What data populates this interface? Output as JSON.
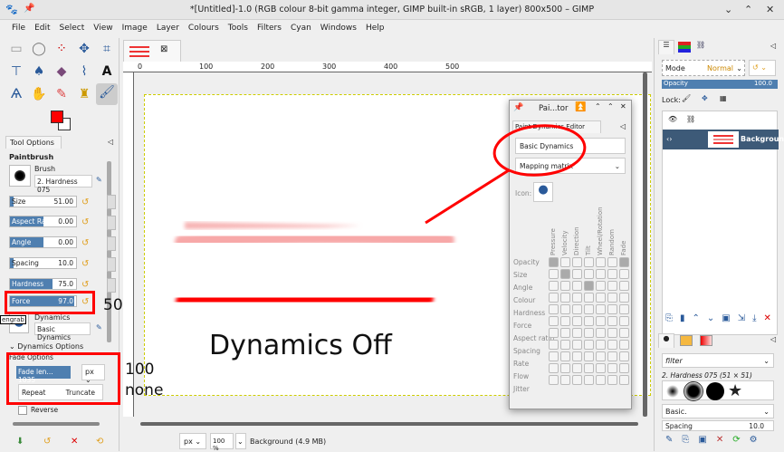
{
  "window": {
    "title": "*[Untitled]-1.0 (RGB colour 8-bit gamma integer, GIMP built-in sRGB, 1 layer) 800x500 – GIMP"
  },
  "menu": [
    "File",
    "Edit",
    "Select",
    "View",
    "Image",
    "Layer",
    "Colours",
    "Tools",
    "Filters",
    "Cyan",
    "Windows",
    "Help"
  ],
  "colors": {
    "foreground": "#ff0000",
    "background": "#ffffff",
    "accent": "#4f7fb0",
    "annotation": "#ff0000"
  },
  "tool_options": {
    "tab": "Tool Options",
    "tool": "Paintbrush",
    "brush_label": "Brush",
    "brush": "2. Hardness 075",
    "sliders": [
      {
        "label": "Size",
        "value": "51.00",
        "fill": 0.05
      },
      {
        "label": "Aspect Ra...",
        "value": "0.00",
        "fill": 0.5
      },
      {
        "label": "Angle",
        "value": "0.00",
        "fill": 0.5
      },
      {
        "label": "Spacing",
        "value": "10.0",
        "fill": 0.05
      },
      {
        "label": "Hardness",
        "value": "75.0",
        "fill": 0.75
      },
      {
        "label": "Force",
        "value": "97.0",
        "fill": 0.97
      }
    ],
    "dynamics_label": "Dynamics",
    "dynamics": "Basic Dynamics",
    "dynamics_options": "Dynamics Options",
    "fade_options": "Fade Options",
    "fade_length_label": "Fade len...",
    "fade_length": "1035",
    "fade_unit": "px",
    "repeat_label": "Repeat",
    "repeat_value": "Truncate",
    "reverse": "Reverse",
    "tooltip": "engrab"
  },
  "ruler": [
    "0",
    "100",
    "200",
    "300",
    "400",
    "500"
  ],
  "canvas": {
    "text": "Dynamics Off"
  },
  "annotations": {
    "force": "50",
    "fade": "100",
    "repeat": "none"
  },
  "statusbar": {
    "unit": "px",
    "zoom": "100 %",
    "info": "Background (4.9 MB)"
  },
  "dynamics_editor": {
    "title": "Pai...tor",
    "tab": "Paint Dynamics Editor",
    "name": "Basic Dynamics",
    "view": "Mapping matrix",
    "icon_label": "Icon:",
    "columns": [
      "Pressure",
      "Velocity",
      "Direction",
      "Tilt",
      "Wheel/Rotation",
      "Random",
      "Fade"
    ],
    "rows": [
      "Opacity",
      "Size",
      "Angle",
      "Colour",
      "Hardness",
      "Force",
      "Aspect ratio",
      "Spacing",
      "Rate",
      "Flow",
      "Jitter"
    ],
    "checked": [
      [
        0,
        0
      ],
      [
        0,
        6
      ],
      [
        1,
        1
      ],
      [
        2,
        3
      ]
    ]
  },
  "layers": {
    "mode_label": "Mode",
    "mode": "Normal",
    "opacity_label": "Opacity",
    "opacity": "100.0",
    "lock_label": "Lock:",
    "layer_name": "Background"
  },
  "brushes": {
    "filter": "filter",
    "selected": "2. Hardness 075 (51 × 51)",
    "preset": "Basic.",
    "spacing_label": "Spacing",
    "spacing": "10.0"
  }
}
